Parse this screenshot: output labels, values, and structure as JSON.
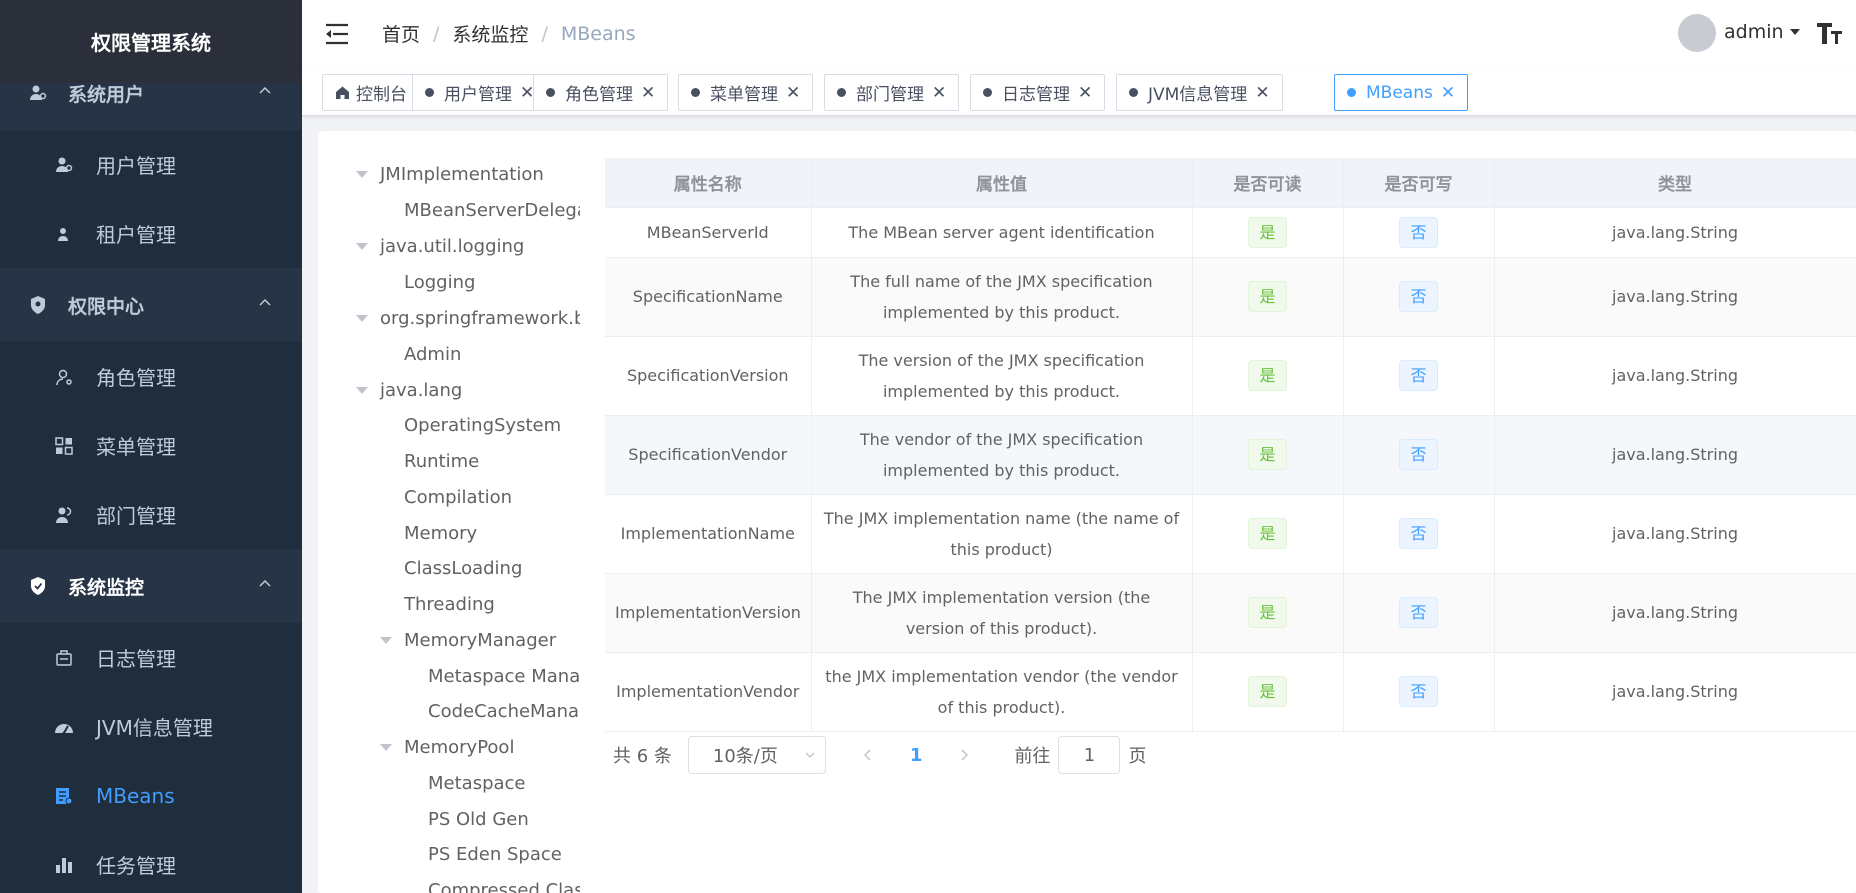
{
  "app": {
    "title": "权限管理系统"
  },
  "sidebar": {
    "groups": [
      {
        "label": "系统用户",
        "icon": "user-gear-icon",
        "items": [
          {
            "label": "用户管理",
            "icon": "user-gear-icon"
          },
          {
            "label": "租户管理",
            "icon": "tenant-icon"
          }
        ]
      },
      {
        "label": "权限中心",
        "icon": "shield-icon",
        "items": [
          {
            "label": "角色管理",
            "icon": "role-icon"
          },
          {
            "label": "菜单管理",
            "icon": "menu-grid-icon"
          },
          {
            "label": "部门管理",
            "icon": "department-icon"
          }
        ]
      },
      {
        "label": "系统监控",
        "icon": "monitor-shield-icon",
        "items": [
          {
            "label": "日志管理",
            "icon": "log-icon"
          },
          {
            "label": "JVM信息管理",
            "icon": "dashboard-icon"
          },
          {
            "label": "MBeans",
            "icon": "mbeans-icon",
            "active": true
          },
          {
            "label": "任务管理",
            "icon": "bar-chart-icon"
          }
        ]
      }
    ]
  },
  "navbar": {
    "breadcrumb": [
      "首页",
      "系统监控",
      "MBeans"
    ],
    "user": "admin"
  },
  "tags": [
    {
      "label": "控制台",
      "type": "home"
    },
    {
      "label": "用户管理"
    },
    {
      "label": "角色管理"
    },
    {
      "label": "菜单管理"
    },
    {
      "label": "部门管理"
    },
    {
      "label": "日志管理"
    },
    {
      "label": "JVM信息管理"
    },
    {
      "label": "MBeans",
      "active": true
    }
  ],
  "tree": [
    {
      "label": "JMImplementation",
      "level": 0,
      "expanded": true
    },
    {
      "label": "MBeanServerDelegate",
      "level": 1
    },
    {
      "label": "java.util.logging",
      "level": 0,
      "expanded": true
    },
    {
      "label": "Logging",
      "level": 1
    },
    {
      "label": "org.springframework.boot",
      "level": 0,
      "expanded": true
    },
    {
      "label": "Admin",
      "level": 1
    },
    {
      "label": "java.lang",
      "level": 0,
      "expanded": true
    },
    {
      "label": "OperatingSystem",
      "level": 1
    },
    {
      "label": "Runtime",
      "level": 1
    },
    {
      "label": "Compilation",
      "level": 1
    },
    {
      "label": "Memory",
      "level": 1
    },
    {
      "label": "ClassLoading",
      "level": 1
    },
    {
      "label": "Threading",
      "level": 1
    },
    {
      "label": "MemoryManager",
      "level": 1,
      "expanded": true
    },
    {
      "label": "Metaspace Manager",
      "level": 2
    },
    {
      "label": "CodeCacheManager",
      "level": 2
    },
    {
      "label": "MemoryPool",
      "level": 1,
      "expanded": true
    },
    {
      "label": "Metaspace",
      "level": 2
    },
    {
      "label": "PS Old Gen",
      "level": 2
    },
    {
      "label": "PS Eden Space",
      "level": 2
    },
    {
      "label": "Compressed Class Space",
      "level": 2
    }
  ],
  "table": {
    "columns": [
      "属性名称",
      "属性值",
      "是否可读",
      "是否可写",
      "类型"
    ],
    "rows": [
      {
        "name": "MBeanServerId",
        "value": "The MBean server agent identification",
        "readable": "是",
        "writable": "否",
        "type": "java.lang.String"
      },
      {
        "name": "SpecificationName",
        "value": "The full name of the JMX specification implemented by this product.",
        "readable": "是",
        "writable": "否",
        "type": "java.lang.String"
      },
      {
        "name": "SpecificationVersion",
        "value": "The version of the JMX specification implemented by this product.",
        "readable": "是",
        "writable": "否",
        "type": "java.lang.String"
      },
      {
        "name": "SpecificationVendor",
        "value": "The vendor of the JMX specification implemented by this product.",
        "readable": "是",
        "writable": "否",
        "type": "java.lang.String"
      },
      {
        "name": "ImplementationName",
        "value": "The JMX implementation name (the name of this product)",
        "readable": "是",
        "writable": "否",
        "type": "java.lang.String"
      },
      {
        "name": "ImplementationVersion",
        "value": "The JMX implementation version (the version of this product).",
        "readable": "是",
        "writable": "否",
        "type": "java.lang.String"
      },
      {
        "name": "ImplementationVendor",
        "value": "the JMX implementation vendor (the vendor of this product).",
        "readable": "是",
        "writable": "否",
        "type": "java.lang.String"
      }
    ]
  },
  "pagination": {
    "total": "共 6 条",
    "page_size": "10条/页",
    "current_page": "1",
    "goto_label": "前往",
    "goto_value": "1",
    "page_suffix": "页"
  },
  "colors": {
    "sidebar_bg": "#304156",
    "sidebar_item_bg": "#1f2d3d",
    "accent": "#409eff",
    "yes": "#67c23a"
  }
}
